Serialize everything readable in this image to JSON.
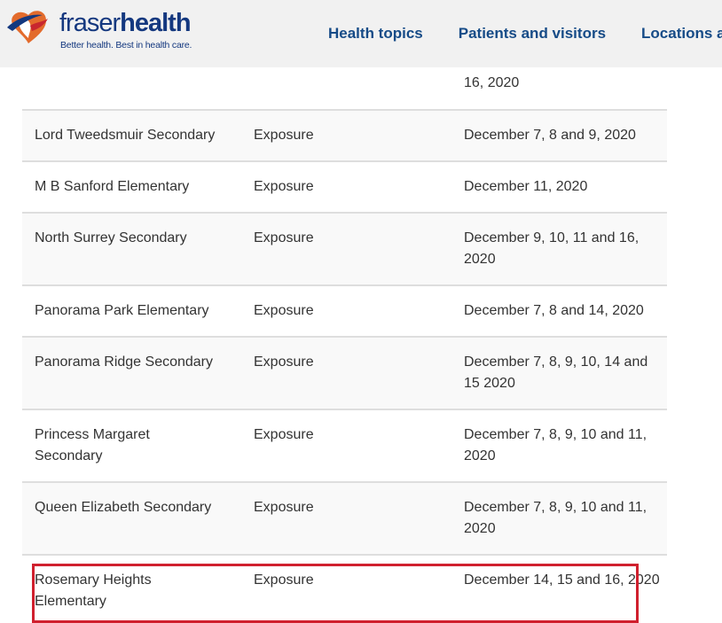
{
  "header": {
    "logo": {
      "word_part1": "fraser",
      "word_part2": "health",
      "tagline": "Better health. Best in health care."
    },
    "nav": [
      {
        "label": "Health topics"
      },
      {
        "label": "Patients and visitors"
      },
      {
        "label": "Locations and"
      }
    ]
  },
  "table": {
    "rows": [
      {
        "school": "",
        "type": "",
        "dates": "16, 2020"
      },
      {
        "school": "Lord Tweedsmuir Secondary",
        "type": "Exposure",
        "dates": " December 7, 8 and 9, 2020"
      },
      {
        "school": "M B Sanford Elementary",
        "type": "Exposure",
        "dates": " December 11, 2020"
      },
      {
        "school": "North Surrey Secondary",
        "type": "Exposure",
        "dates": " December 9, 10, 11 and 16, 2020"
      },
      {
        "school": "Panorama Park Elementary",
        "type": "Exposure",
        "dates": " December 7, 8 and 14, 2020"
      },
      {
        "school": "Panorama Ridge Secondary",
        "type": "Exposure",
        "dates": " December 7, 8, 9, 10, 14 and 15 2020"
      },
      {
        "school": " Princess Margaret Secondary",
        "type": "Exposure",
        "dates": " December 7, 8, 9, 10 and 11, 2020"
      },
      {
        "school": "Queen Elizabeth Secondary",
        "type": "Exposure",
        "dates": " December 7, 8, 9, 10 and 11, 2020"
      },
      {
        "school": " Rosemary Heights Elementary",
        "type": "Exposure",
        "dates": " December 14, 15 and 16, 2020"
      }
    ]
  },
  "colors": {
    "header_bg": "#f1f1f1",
    "brand_blue": "#14387f",
    "brand_orange": "#e36b2c",
    "brand_red": "#c8262e",
    "nav_text": "#164b87",
    "row_alt_bg": "#f9f9f9",
    "row_border": "#dedede",
    "highlight_box": "#d0202e"
  },
  "icons": {
    "logo": "fraserhealth-heart-logo-icon"
  }
}
